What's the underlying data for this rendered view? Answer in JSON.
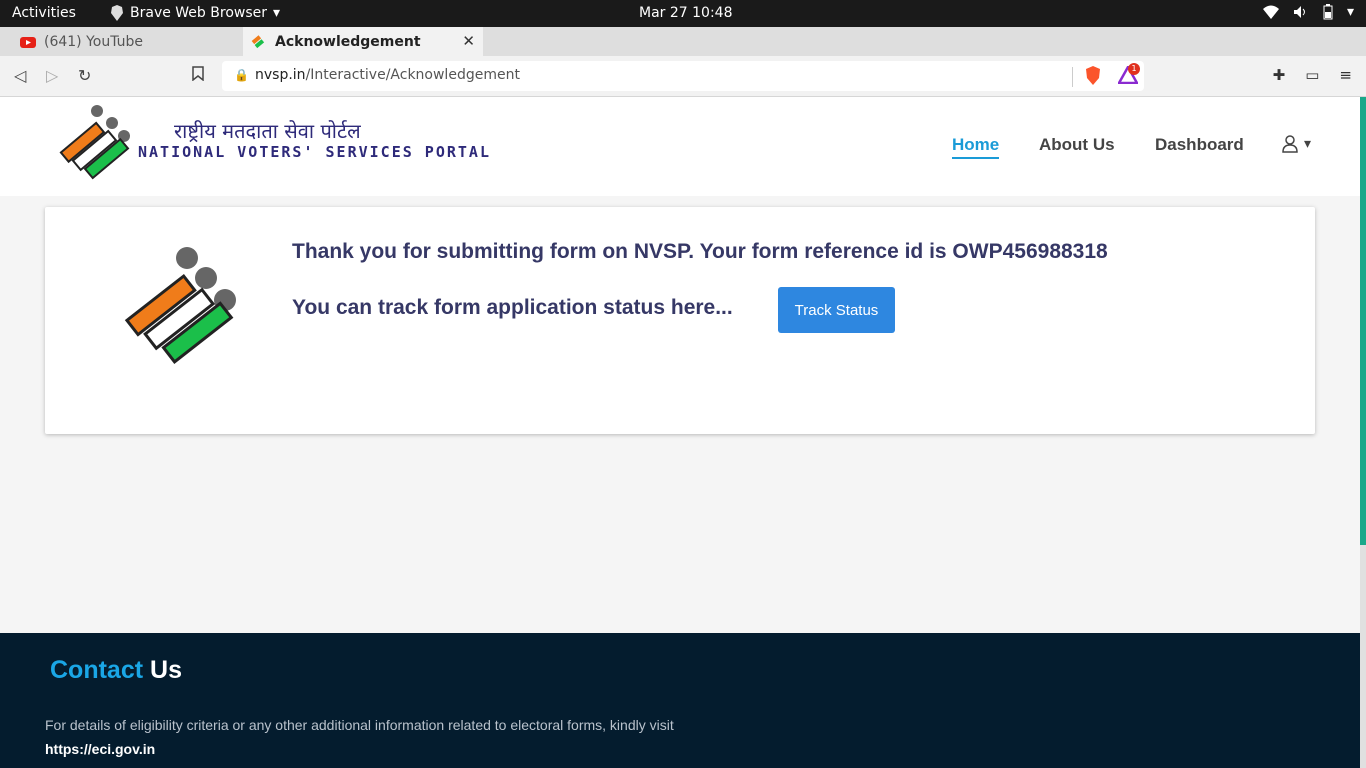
{
  "os": {
    "activities": "Activities",
    "app_name": "Brave Web Browser",
    "clock": "Mar 27  10:48"
  },
  "tabs": [
    {
      "label": "(641) YouTube"
    },
    {
      "label": "Acknowledgement"
    }
  ],
  "address": {
    "host": "nvsp.in",
    "path": "/Interactive/Acknowledgement",
    "rewards_badge": "1"
  },
  "site": {
    "hindi_title": "राष्ट्रीय मतदाता सेवा पोर्टल",
    "english_title": "NATIONAL VOTERS' SERVICES PORTAL",
    "nav": {
      "home": "Home",
      "about": "About Us",
      "dashboard": "Dashboard"
    }
  },
  "card": {
    "message1": "Thank you for submitting form on NVSP. Your form reference id is OWP456988318",
    "message2": "You can track form application status here...",
    "track_button": "Track Status"
  },
  "footer": {
    "contact_part1": "Contact",
    "contact_part2": " Us",
    "description": "For details of eligibility criteria or any other additional information related to electoral forms, kindly visit",
    "link": "https://eci.gov.in"
  },
  "colors": {
    "accent": "#1a9bd7",
    "button": "#2e87e0",
    "footer_bg": "#041c2e",
    "logo_orange": "#f07c1a",
    "logo_green": "#1bbf4a"
  }
}
